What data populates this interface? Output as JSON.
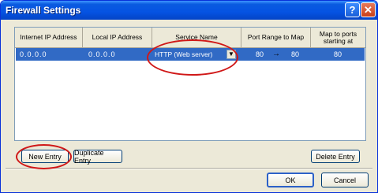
{
  "window": {
    "title": "Firewall Settings"
  },
  "title_buttons": {
    "help": "?",
    "close": "✕"
  },
  "table": {
    "headers": [
      "Internet IP Address",
      "Local IP Address",
      "Service Name",
      "Port Range to Map",
      "Map to ports starting at"
    ],
    "rows": [
      {
        "internet_ip": "0.0.0.0",
        "local_ip": "0.0.0.0",
        "service": "HTTP (Web server)",
        "port_start": "80",
        "port_arrow": "→",
        "port_end": "80",
        "map_to": "80"
      }
    ]
  },
  "buttons": {
    "new_entry": "New Entry",
    "duplicate_entry": "Duplicate Entry",
    "delete_entry": "Delete Entry",
    "ok": "OK",
    "cancel": "Cancel"
  },
  "colors": {
    "title_bar": "#0553e3",
    "selection": "#316ac5",
    "highlight_ring": "#d01818"
  },
  "icons": {
    "dropdown": "chevron-down-icon",
    "help": "help-icon",
    "close": "close-icon"
  }
}
